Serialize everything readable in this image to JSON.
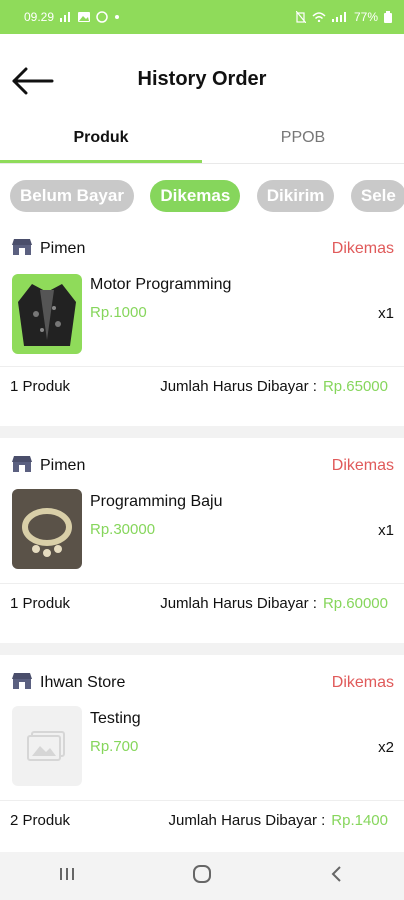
{
  "status_bar": {
    "time": "09.29",
    "battery": "77%"
  },
  "header": {
    "title": "History Order"
  },
  "tabs": [
    {
      "label": "Produk",
      "active": true
    },
    {
      "label": "PPOB",
      "active": false
    }
  ],
  "filters": [
    {
      "label": "Belum Bayar",
      "active": false
    },
    {
      "label": "Dikemas",
      "active": true
    },
    {
      "label": "Dikirim",
      "active": false
    },
    {
      "label": "Sele",
      "active": false
    }
  ],
  "orders": [
    {
      "store": "Pimen",
      "status": "Dikemas",
      "product_name": "Motor Programming",
      "price": "Rp.1000",
      "qty": "x1",
      "count_label": "1 Produk",
      "total_label": "Jumlah Harus Dibayar :",
      "total": "Rp.65000",
      "image": "jacket"
    },
    {
      "store": "Pimen",
      "status": "Dikemas",
      "product_name": "Programming Baju",
      "price": "Rp.30000",
      "qty": "x1",
      "count_label": "1 Produk",
      "total_label": "Jumlah Harus Dibayar :",
      "total": "Rp.60000",
      "image": "jewelry"
    },
    {
      "store": "Ihwan Store",
      "status": "Dikemas",
      "product_name": "Testing",
      "price": "Rp.700",
      "qty": "x2",
      "count_label": "2 Produk",
      "total_label": "Jumlah Harus Dibayar :",
      "total": "Rp.1400",
      "image": "placeholder"
    }
  ],
  "colors": {
    "accent": "#86d65c",
    "status": "#e05a5a",
    "chip_inactive": "#c9c9c9"
  }
}
